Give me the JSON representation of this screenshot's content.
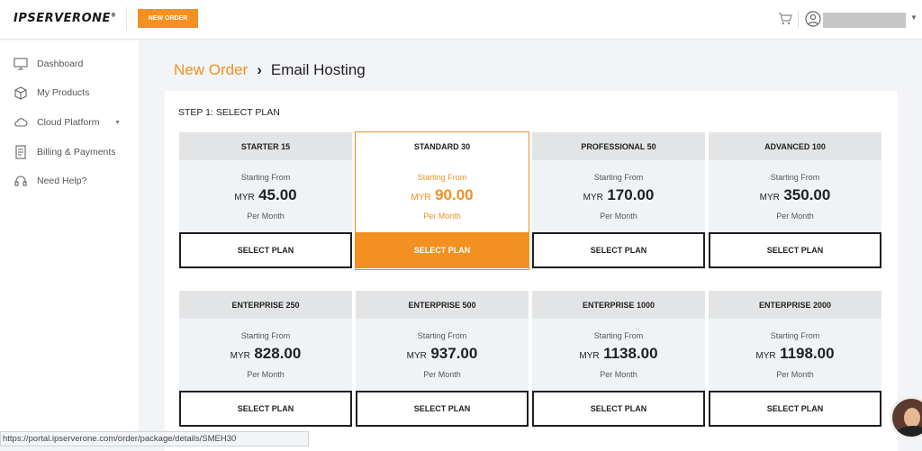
{
  "brand": {
    "logo_text": "IPSERVERONE",
    "trademark": "®"
  },
  "header": {
    "new_order_label": "NEW ORDER",
    "cart_icon": "cart-icon",
    "user_icon": "user-icon",
    "chevron_icon": "chevron-down-icon"
  },
  "sidebar": {
    "items": [
      {
        "label": "Dashboard",
        "icon": "monitor-icon"
      },
      {
        "label": "My Products",
        "icon": "box-icon"
      },
      {
        "label": "Cloud Platform",
        "icon": "cloud-icon",
        "has_chevron": true
      },
      {
        "label": "Billing & Payments",
        "icon": "invoice-icon"
      },
      {
        "label": "Need Help?",
        "icon": "headset-icon"
      }
    ]
  },
  "breadcrumb": {
    "parent": "New Order",
    "separator": "›",
    "current": "Email Hosting"
  },
  "step": {
    "title": "STEP 1: SELECT PLAN"
  },
  "plans": [
    {
      "name": "STARTER 15",
      "starting_from": "Starting From",
      "currency": "MYR",
      "price": "45.00",
      "period": "Per Month",
      "button": "SELECT PLAN",
      "active": false
    },
    {
      "name": "STANDARD 30",
      "starting_from": "Starting From",
      "currency": "MYR",
      "price": "90.00",
      "period": "Per Month",
      "button": "SELECT PLAN",
      "active": true
    },
    {
      "name": "PROFESSIONAL 50",
      "starting_from": "Starting From",
      "currency": "MYR",
      "price": "170.00",
      "period": "Per Month",
      "button": "SELECT PLAN",
      "active": false
    },
    {
      "name": "ADVANCED 100",
      "starting_from": "Starting From",
      "currency": "MYR",
      "price": "350.00",
      "period": "Per Month",
      "button": "SELECT PLAN",
      "active": false
    },
    {
      "name": "ENTERPRISE 250",
      "starting_from": "Starting From",
      "currency": "MYR",
      "price": "828.00",
      "period": "Per Month",
      "button": "SELECT PLAN",
      "active": false
    },
    {
      "name": "ENTERPRISE 500",
      "starting_from": "Starting From",
      "currency": "MYR",
      "price": "937.00",
      "period": "Per Month",
      "button": "SELECT PLAN",
      "active": false
    },
    {
      "name": "ENTERPRISE 1000",
      "starting_from": "Starting From",
      "currency": "MYR",
      "price": "1138.00",
      "period": "Per Month",
      "button": "SELECT PLAN",
      "active": false
    },
    {
      "name": "ENTERPRISE 2000",
      "starting_from": "Starting From",
      "currency": "MYR",
      "price": "1198.00",
      "period": "Per Month",
      "button": "SELECT PLAN",
      "active": false
    }
  ],
  "status_bar": {
    "url": "https://portal.ipserverone.com/order/package/details/SMEH30"
  },
  "colors": {
    "accent": "#f29121",
    "text_dark": "#222222",
    "card_bg": "#f0f3f6",
    "card_head": "#e2e4e6"
  }
}
